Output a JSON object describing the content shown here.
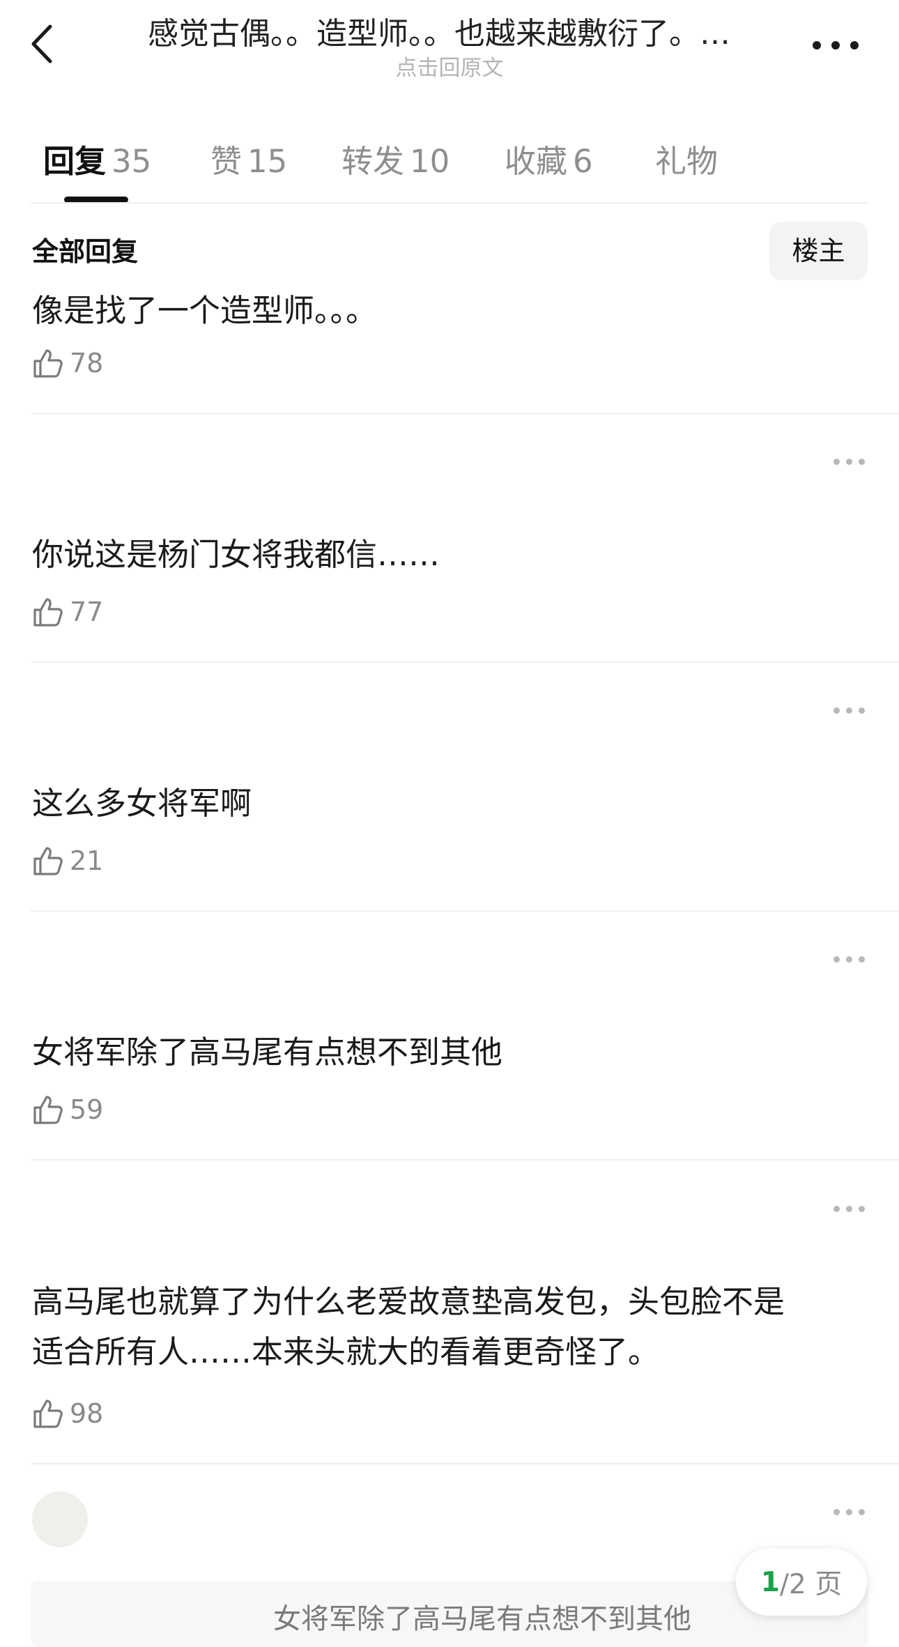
{
  "header": {
    "title": "感觉古偶。。造型师。。也越来越敷衍了。…",
    "subtitle": "点击回原文"
  },
  "tabs": [
    {
      "label": "回复",
      "count": "35",
      "active": true
    },
    {
      "label": "赞",
      "count": "15"
    },
    {
      "label": "转发",
      "count": "10"
    },
    {
      "label": "收藏",
      "count": "6"
    },
    {
      "label": "礼物",
      "count": ""
    }
  ],
  "section": {
    "title": "全部回复",
    "owner_button": "楼主"
  },
  "comments": [
    {
      "text": "像是找了一个造型师。。。",
      "likes": "78"
    },
    {
      "text": "你说这是杨门女将我都信……",
      "likes": "77"
    },
    {
      "text": "这么多女将军啊",
      "likes": "21"
    },
    {
      "text": "女将军除了高马尾有点想不到其他",
      "likes": "59"
    },
    {
      "text_line1": "高马尾也就算了为什么老爱故意垫高发包，头包脸不是",
      "text_line2": "适合所有人……本来头就大的看着更奇怪了。",
      "likes": "98"
    }
  ],
  "quote_bar": {
    "text": "女将军除了高马尾有点想不到其他"
  },
  "pager": {
    "current": "1",
    "rest": "/2 页"
  },
  "icons": [
    "back-arrow-icon",
    "more-icon",
    "thumb-up-icon",
    "ellipsis-icon"
  ]
}
